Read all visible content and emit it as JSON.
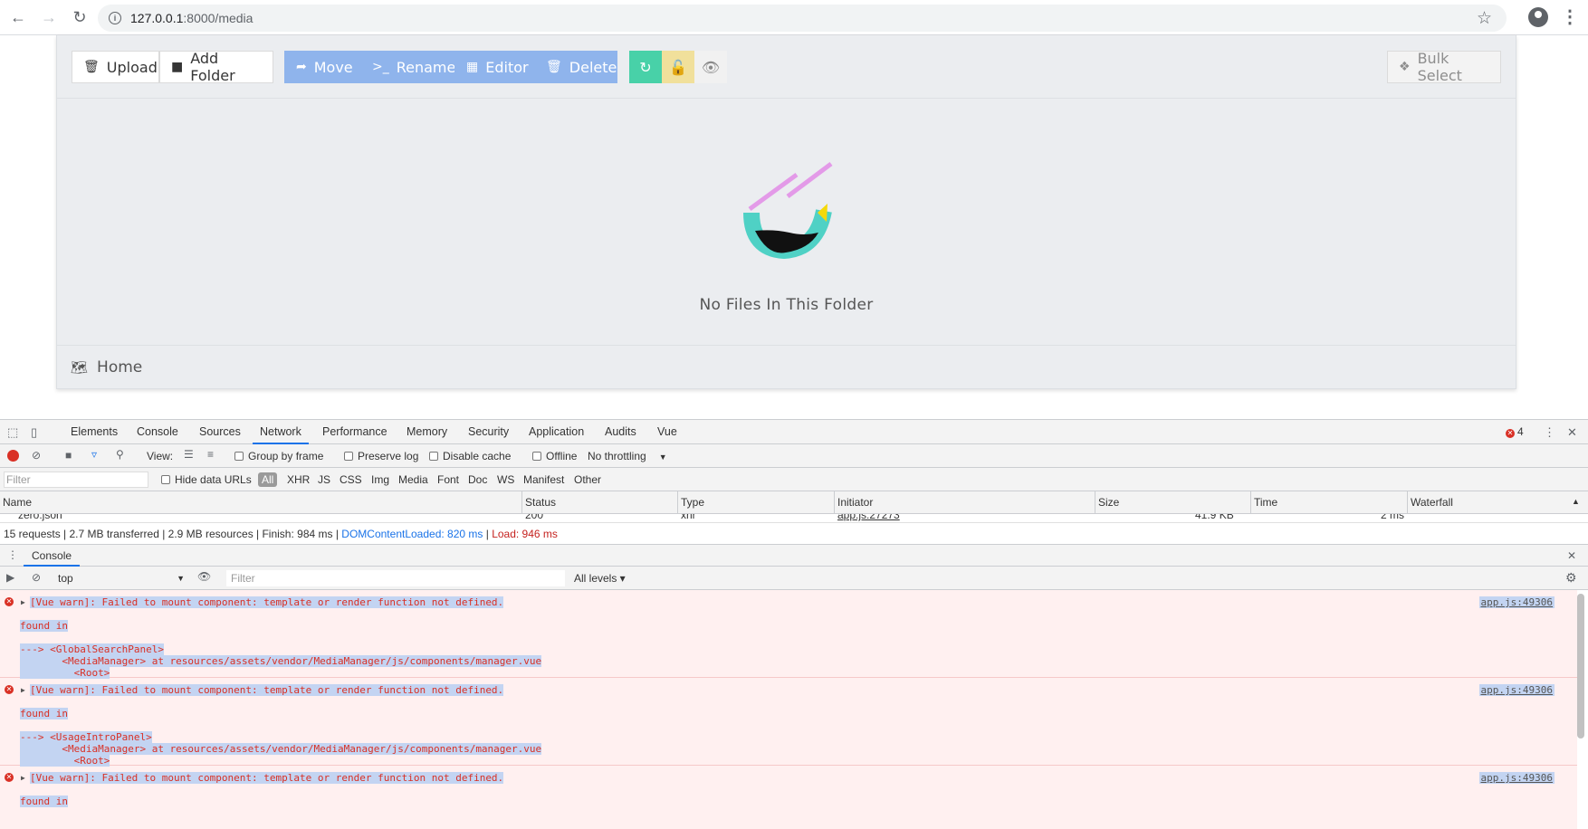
{
  "browser": {
    "url_host": "127.0.0.1",
    "url_path": ":8000/media"
  },
  "toolbar": {
    "upload": "Upload",
    "add_folder": "Add Folder",
    "move": "Move",
    "rename": "Rename",
    "editor": "Editor",
    "delete": "Delete",
    "bulk_select": "Bulk Select",
    "colors": {
      "blue": "#8fb4ec",
      "green": "#48d1a8",
      "yellow": "#f1e09b"
    }
  },
  "empty_state": {
    "message": "No Files In This Folder"
  },
  "breadcrumb": {
    "home": "Home"
  },
  "devtools": {
    "tabs": [
      "Elements",
      "Console",
      "Sources",
      "Network",
      "Performance",
      "Memory",
      "Security",
      "Application",
      "Audits",
      "Vue"
    ],
    "active_tab": "Network",
    "error_count": "4",
    "network_toolbar": {
      "view_label": "View:",
      "group_by_frame": "Group by frame",
      "preserve_log": "Preserve log",
      "disable_cache": "Disable cache",
      "offline": "Offline",
      "throttling": "No throttling"
    },
    "filter_bar": {
      "placeholder": "Filter",
      "hide_data_urls": "Hide data URLs",
      "types": [
        "All",
        "XHR",
        "JS",
        "CSS",
        "Img",
        "Media",
        "Font",
        "Doc",
        "WS",
        "Manifest",
        "Other"
      ]
    },
    "columns": [
      "Name",
      "Status",
      "Type",
      "Initiator",
      "Size",
      "Time",
      "Waterfall"
    ],
    "row": {
      "name": "zero.json",
      "status": "200",
      "type": "xhr",
      "initiator": "app.js:27273",
      "size": "41.9 KB",
      "time": "2 ms"
    },
    "summary": {
      "main": "15 requests | 2.7 MB transferred | 2.9 MB resources | Finish: 984 ms | ",
      "dom": "DOMContentLoaded: 820 ms",
      "sep": " | ",
      "load": "Load: 946 ms"
    },
    "console": {
      "tab": "Console",
      "context": "top",
      "filter_placeholder": "Filter",
      "levels": "All levels ▾",
      "messages": [
        {
          "text": "[Vue warn]: Failed to mount component: template or render function not defined.",
          "found": "found in",
          "trace1": "---> <GlobalSearchPanel>",
          "trace2": "       <MediaManager> at resources/assets/vendor/MediaManager/js/components/manager.vue",
          "trace3": "         <Root>",
          "source": "app.js:49306"
        },
        {
          "text": "[Vue warn]: Failed to mount component: template or render function not defined.",
          "found": "found in",
          "trace1": "---> <UsageIntroPanel>",
          "trace2": "       <MediaManager> at resources/assets/vendor/MediaManager/js/components/manager.vue",
          "trace3": "         <Root>",
          "source": "app.js:49306"
        },
        {
          "text": "[Vue warn]: Failed to mount component: template or render function not defined.",
          "found": "found in",
          "source": "app.js:49306"
        }
      ]
    }
  }
}
